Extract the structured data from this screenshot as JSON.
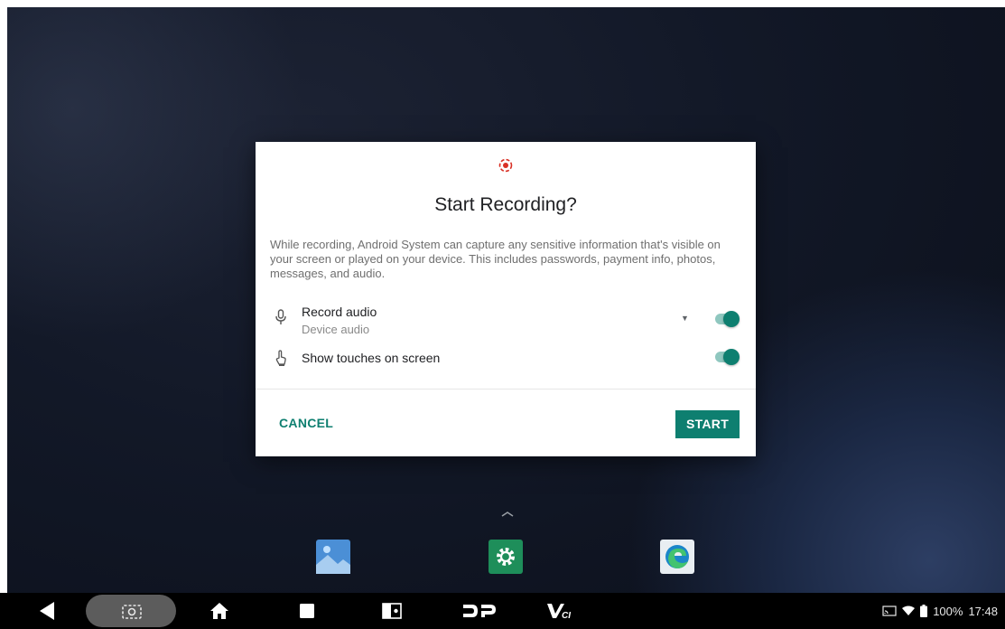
{
  "dialog": {
    "title": "Start Recording?",
    "description": "While recording, Android System can capture any sensitive information that's visible on your screen or played on your device. This includes passwords, payment info, photos, messages, and audio.",
    "record_audio": {
      "label": "Record audio",
      "sublabel": "Device audio",
      "enabled": true,
      "icon": "microphone-icon"
    },
    "show_touches": {
      "label": "Show touches on screen",
      "enabled": true,
      "icon": "touch-icon"
    },
    "cancel_label": "CANCEL",
    "start_label": "START"
  },
  "dock": {
    "apps": [
      {
        "name": "Gallery",
        "icon": "gallery-icon"
      },
      {
        "name": "Settings",
        "icon": "settings-icon"
      },
      {
        "name": "Edge",
        "icon": "edge-browser-icon"
      }
    ]
  },
  "navbar": {
    "icons": [
      "back-icon",
      "screenshot-icon",
      "home-icon",
      "recents-icon",
      "split-screen-icon",
      "dp-icon",
      "vci-icon"
    ],
    "status": {
      "battery": "100%",
      "time": "17:48"
    }
  },
  "colors": {
    "accent": "#0e7f70",
    "record_red": "#d93025"
  }
}
